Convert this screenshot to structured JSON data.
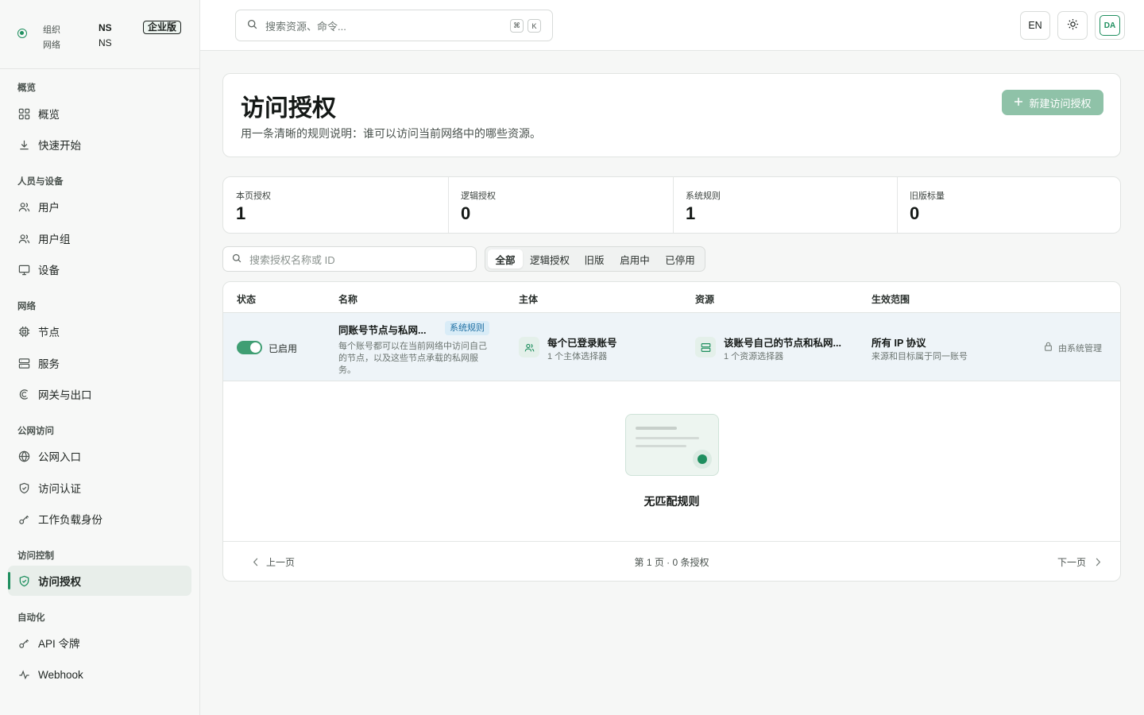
{
  "org": {
    "org_label": "组织",
    "org_value": "NS",
    "net_label": "网络",
    "net_value": "NS",
    "badge": "企业版"
  },
  "sidebar": {
    "sections": [
      {
        "title": "概览",
        "items": [
          {
            "label": "概览",
            "icon": "grid-icon"
          },
          {
            "label": "快速开始",
            "icon": "download-icon"
          }
        ]
      },
      {
        "title": "人员与设备",
        "items": [
          {
            "label": "用户",
            "icon": "users-icon"
          },
          {
            "label": "用户组",
            "icon": "users-icon"
          },
          {
            "label": "设备",
            "icon": "monitor-icon"
          }
        ]
      },
      {
        "title": "网络",
        "items": [
          {
            "label": "节点",
            "icon": "cpu-icon"
          },
          {
            "label": "服务",
            "icon": "server-icon"
          },
          {
            "label": "网关与出口",
            "icon": "gateway-icon"
          }
        ]
      },
      {
        "title": "公网访问",
        "items": [
          {
            "label": "公网入口",
            "icon": "globe-icon"
          },
          {
            "label": "访问认证",
            "icon": "shield-icon"
          },
          {
            "label": "工作负载身份",
            "icon": "key-icon"
          }
        ]
      },
      {
        "title": "访问控制",
        "items": [
          {
            "label": "访问授权",
            "icon": "shield-check-icon",
            "active": true
          }
        ]
      },
      {
        "title": "自动化",
        "items": [
          {
            "label": "API 令牌",
            "icon": "key-icon"
          },
          {
            "label": "Webhook",
            "icon": "activity-icon"
          }
        ]
      }
    ]
  },
  "topbar": {
    "search_placeholder": "搜索资源、命令...",
    "kbd1": "⌘",
    "kbd2": "K",
    "lang": "EN",
    "avatar": "DA"
  },
  "page": {
    "title": "访问授权",
    "subtitle": "用一条清晰的规则说明：谁可以访问当前网络中的哪些资源。",
    "new_button": "新建访问授权"
  },
  "stats": [
    {
      "label": "本页授权",
      "value": "1"
    },
    {
      "label": "逻辑授权",
      "value": "0"
    },
    {
      "label": "系统规则",
      "value": "1"
    },
    {
      "label": "旧版标量",
      "value": "0"
    }
  ],
  "filter": {
    "search_placeholder": "搜索授权名称或 ID",
    "tabs": [
      "全部",
      "逻辑授权",
      "旧版",
      "启用中",
      "已停用"
    ],
    "active_tab": "全部"
  },
  "table": {
    "headers": [
      "状态",
      "名称",
      "主体",
      "资源",
      "生效范围"
    ],
    "row": {
      "status": "已启用",
      "enabled": true,
      "name": "同账号节点与私网...",
      "name_badge": "系统规则",
      "desc": [
        "每个账号都可以在当前网络中访问自己",
        "的节点，以及这些节点承载的私网服",
        "务。"
      ],
      "subject": "每个已登录账号",
      "subject_sub": "1 个主体选择器",
      "resource": "该账号自己的节点和私网...",
      "resource_sub": "1 个资源选择器",
      "scope": "所有 IP 协议",
      "scope_sub": "来源和目标属于同一账号",
      "managed": "由系统管理"
    },
    "empty_text": "无匹配规则"
  },
  "pager": {
    "prev": "上一页",
    "info": "第 1 页 · 0 条授权",
    "next": "下一页"
  }
}
